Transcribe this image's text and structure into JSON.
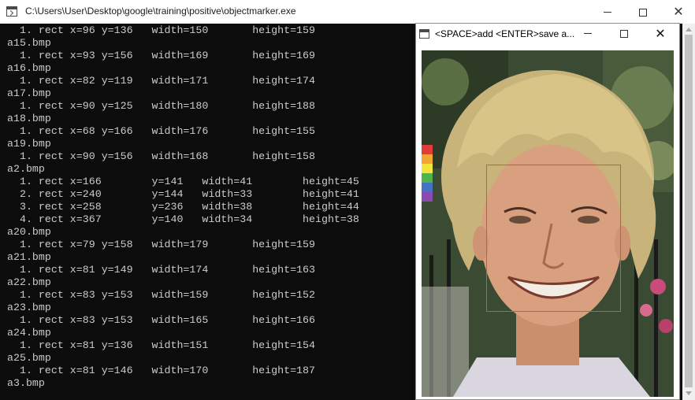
{
  "console_window": {
    "title": "C:\\Users\\User\\Desktop\\google\\training\\positive\\objectmarker.exe",
    "lines": [
      "  1. rect x=96 y=136   width=150       height=159",
      "a15.bmp",
      "  1. rect x=93 y=156   width=169       height=169",
      "a16.bmp",
      "  1. rect x=82 y=119   width=171       height=174",
      "a17.bmp",
      "  1. rect x=90 y=125   width=180       height=188",
      "a18.bmp",
      "  1. rect x=68 y=166   width=176       height=155",
      "a19.bmp",
      "  1. rect x=90 y=156   width=168       height=158",
      "a2.bmp",
      "  1. rect x=166        y=141   width=41        height=45",
      "  2. rect x=240        y=144   width=33        height=41",
      "  3. rect x=258        y=236   width=38        height=44",
      "  4. rect x=367        y=140   width=34        height=38",
      "a20.bmp",
      "  1. rect x=79 y=158   width=179       height=159",
      "a21.bmp",
      "  1. rect x=81 y=149   width=174       height=163",
      "a22.bmp",
      "  1. rect x=83 y=153   width=159       height=152",
      "a23.bmp",
      "  1. rect x=83 y=153   width=165       height=166",
      "a24.bmp",
      "  1. rect x=81 y=136   width=151       height=154",
      "a25.bmp",
      "  1. rect x=81 y=146   width=170       height=187",
      "a3.bmp"
    ]
  },
  "viewer_window": {
    "title": "<SPACE>add <ENTER>save a...",
    "marker_color": "#e030e0"
  },
  "icons": {
    "app": "console-app-icon",
    "minimize": "minimize-icon",
    "maximize": "maximize-icon",
    "close": "close-icon"
  },
  "colors": {
    "console_bg": "#0c0c0c",
    "console_text": "#cccccc"
  }
}
